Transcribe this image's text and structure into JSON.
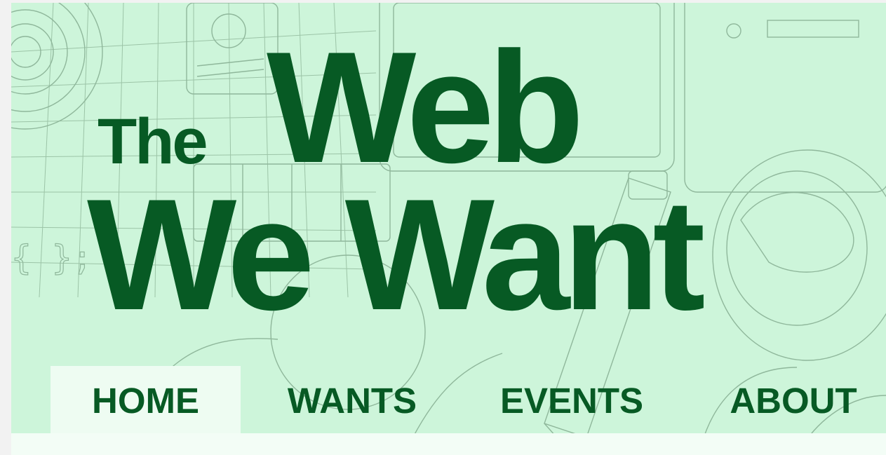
{
  "site": {
    "logo_the": "The",
    "logo_web": "Web",
    "logo_we_want": "We Want"
  },
  "nav": {
    "items": [
      {
        "label": "HOME",
        "active": true
      },
      {
        "label": "WANTS",
        "active": false
      },
      {
        "label": "EVENTS",
        "active": false
      },
      {
        "label": "ABOUT",
        "active": false
      }
    ]
  },
  "colors": {
    "brand_green": "#075a24",
    "header_bg": "#cdf5da",
    "active_tab_bg": "#eefcf2",
    "line_art": "#8fb79b"
  }
}
